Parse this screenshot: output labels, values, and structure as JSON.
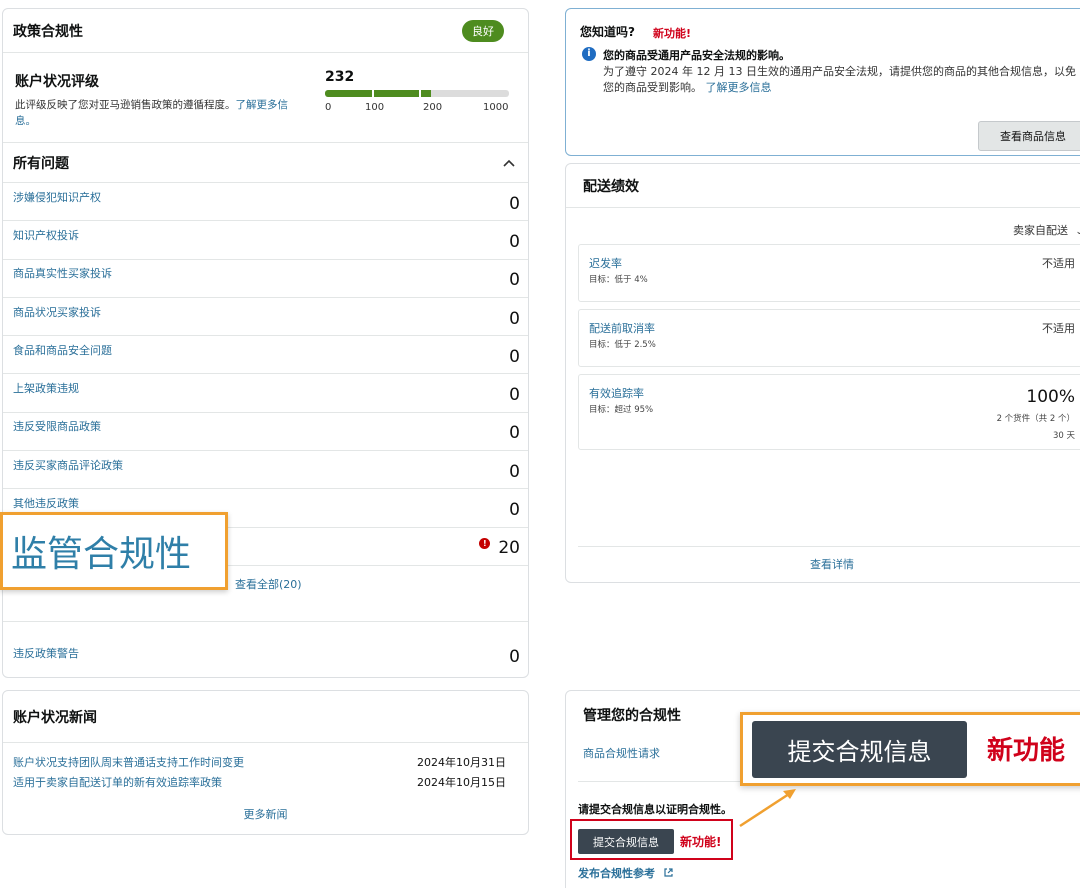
{
  "policy": {
    "title": "政策合规性",
    "status_badge": "良好",
    "health": {
      "title": "账户状况评级",
      "description": "此评级反映了您对亚马逊销售政策的遵循程度。",
      "learn_more": "了解更多信息。",
      "score": "232",
      "score_value": 232,
      "tick_labels": [
        "0",
        "100",
        "200",
        "1000"
      ]
    },
    "issues_title": "所有问题",
    "issues": [
      {
        "label": "涉嫌侵犯知识产权",
        "count": "0"
      },
      {
        "label": "知识产权投诉",
        "count": "0"
      },
      {
        "label": "商品真实性买家投诉",
        "count": "0"
      },
      {
        "label": "商品状况买家投诉",
        "count": "0"
      },
      {
        "label": "食品和商品安全问题",
        "count": "0"
      },
      {
        "label": "上架政策违规",
        "count": "0"
      },
      {
        "label": "违反受限商品政策",
        "count": "0"
      },
      {
        "label": "违反买家商品评论政策",
        "count": "0"
      },
      {
        "label": "其他违反政策",
        "count": "0"
      },
      {
        "label": "",
        "count": "20"
      }
    ],
    "view_all": "查看全部(20)",
    "violation_warning": {
      "label": "违反政策警告",
      "count": "0"
    },
    "callout": "监管合规性"
  },
  "news": {
    "title": "账户状况新闻",
    "items": [
      {
        "title": "账户状况支持团队周末普通话支持工作时间变更",
        "date": "2024年10月31日"
      },
      {
        "title": "适用于卖家自配送订单的新有效追踪率政策",
        "date": "2024年10月15日"
      }
    ],
    "more": "更多新闻"
  },
  "did_you_know": {
    "question": "您知道吗?",
    "new_badge": "新功能!",
    "headline": "您的商品受通用产品安全法规的影响。",
    "body": "为了遵守 2024 年 12 月 13 日生效的通用产品安全法规，请提供您的商品的其他合规信息，以免您的商品受到影响。",
    "learn_more": "了解更多信息",
    "button": "查看商品信息"
  },
  "shipping": {
    "title": "配送绩效",
    "filter": "卖家自配送",
    "metrics": [
      {
        "label": "迟发率",
        "target": "目标：低于 4%",
        "value": "不适用"
      },
      {
        "label": "配送前取消率",
        "target": "目标：低于 2.5%",
        "value": "不适用"
      },
      {
        "label": "有效追踪率",
        "target": "目标：超过 95%",
        "value": "100%",
        "sub1": "2 个货件（共 2 个）",
        "sub2": "30 天"
      }
    ],
    "details": "查看详情"
  },
  "manage": {
    "title": "管理您的合规性",
    "request_link": "商品合规性请求",
    "prompt": "请提交合规信息以证明合规性。",
    "submit": "提交合规信息",
    "new_badge": "新功能!",
    "reference": "发布合规性参考",
    "callout_submit": "提交合规信息",
    "callout_new": "新功能"
  },
  "colors": {
    "accent_green": "#4e8c1f",
    "link_blue": "#2a6f99",
    "alert_red": "#d0021b",
    "callout_orange": "#f0a030",
    "button_dark": "#3a4550"
  }
}
